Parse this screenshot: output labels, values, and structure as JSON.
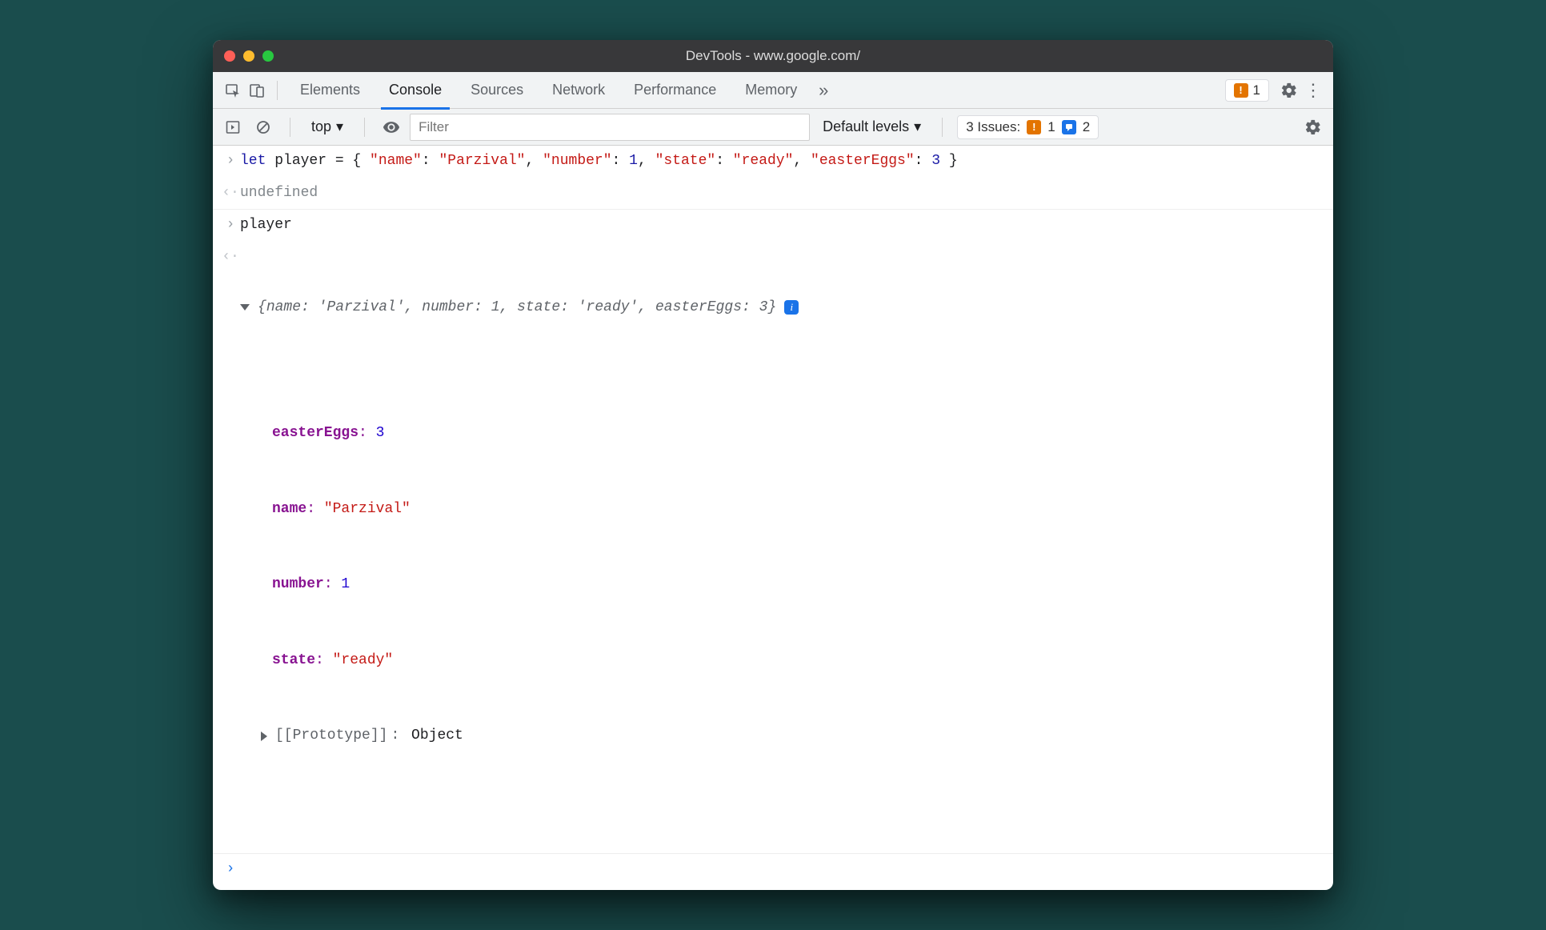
{
  "window": {
    "title": "DevTools - www.google.com/"
  },
  "tabs": {
    "items": [
      "Elements",
      "Console",
      "Sources",
      "Network",
      "Performance",
      "Memory"
    ],
    "active_index": 1,
    "warn_count": "1"
  },
  "toolbar": {
    "context": "top",
    "filter_placeholder": "Filter",
    "levels": "Default levels",
    "issues_label": "3 Issues:",
    "issues_warn": "1",
    "issues_info": "2"
  },
  "console": {
    "input1_tokens": {
      "let": "let",
      "varname": "player",
      "eq": " = { ",
      "k1": "\"name\"",
      "c1": ": ",
      "v1": "\"Parzival\"",
      "s1": ", ",
      "k2": "\"number\"",
      "c2": ": ",
      "v2": "1",
      "s2": ", ",
      "k3": "\"state\"",
      "c3": ": ",
      "v3": "\"ready\"",
      "s3": ", ",
      "k4": "\"easterEggs\"",
      "c4": ": ",
      "v4": "3",
      "end": " }"
    },
    "result1": "undefined",
    "input2": "player",
    "obj_summary": {
      "open": "{",
      "p1k": "name",
      "p1v": "'Parzival'",
      "p2k": "number",
      "p2v": "1",
      "p3k": "state",
      "p3v": "'ready'",
      "p4k": "easterEggs",
      "p4v": "3",
      "close": "}"
    },
    "obj_props": {
      "easterEggs": {
        "k": "easterEggs",
        "v": "3"
      },
      "name": {
        "k": "name",
        "v": "\"Parzival\""
      },
      "number": {
        "k": "number",
        "v": "1"
      },
      "state": {
        "k": "state",
        "v": "\"ready\""
      },
      "proto_label": "[[Prototype]]",
      "proto_value": "Object"
    }
  }
}
